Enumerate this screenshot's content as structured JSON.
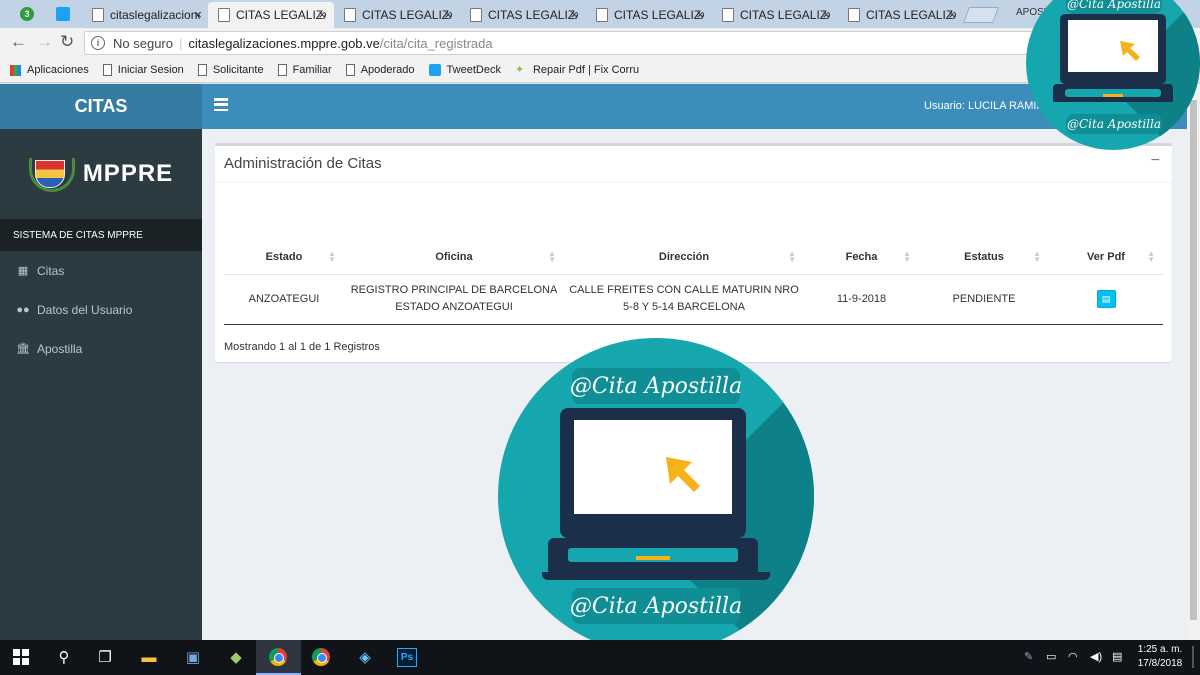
{
  "browser": {
    "pinned_tabs": [
      {
        "icon": "whatsapp-icon",
        "badge": "3"
      },
      {
        "icon": "twitter-icon"
      }
    ],
    "tabs": [
      {
        "title": "citaslegalizaciones",
        "active": false
      },
      {
        "title": "CITAS LEGALIZACIONES",
        "active": true
      },
      {
        "title": "CITAS LEGALIZACIONES",
        "active": false
      },
      {
        "title": "CITAS LEGALIZACIONES",
        "active": false
      },
      {
        "title": "CITAS LEGALIZACIONES",
        "active": false
      },
      {
        "title": "CITAS LEGALIZACIONES",
        "active": false
      },
      {
        "title": "CITAS LEGALIZACIONES",
        "active": false
      }
    ],
    "tab_close": "×",
    "profile_label": "APOSTI",
    "nav": {
      "back": "←",
      "forward": "→",
      "reload": "↻"
    },
    "address": {
      "security": "No seguro",
      "host": "citaslegalizaciones.mppre.gob.ve",
      "path": "/cita/cita_registrada"
    },
    "bookmarks": [
      {
        "label": "Aplicaciones",
        "icon": "apps-grid-icon"
      },
      {
        "label": "Iniciar Sesion",
        "icon": "page-icon"
      },
      {
        "label": "Solicitante",
        "icon": "page-icon"
      },
      {
        "label": "Familiar",
        "icon": "page-icon"
      },
      {
        "label": "Apoderado",
        "icon": "page-icon"
      },
      {
        "label": "TweetDeck",
        "icon": "twitter-icon"
      },
      {
        "label": "Repair Pdf | Fix Corru",
        "icon": "fix-icon"
      }
    ]
  },
  "app": {
    "brand": "CITAS",
    "logo_text": "MPPRE",
    "sidebar_header": "SISTEMA DE CITAS MPPRE",
    "menu": [
      {
        "label": "Citas",
        "icon": "calendar-icon"
      },
      {
        "label": "Datos del Usuario",
        "icon": "users-icon"
      },
      {
        "label": "Apostilla",
        "icon": "institution-icon"
      }
    ],
    "user_label": "Usuario: LUCILA RAMIREZ",
    "colors": {
      "header": "#3c8dbc",
      "sidebar": "#2c3b41",
      "brand": "#357ca5",
      "pdf_button": "#00c0ef"
    }
  },
  "panel": {
    "title": "Administración de Citas",
    "collapse": "−",
    "columns": [
      "Estado",
      "Oficina",
      "Dirección",
      "Fecha",
      "Estatus",
      "Ver Pdf"
    ],
    "rows": [
      {
        "estado": "ANZOATEGUI",
        "oficina_1": "REGISTRO PRINCIPAL DE BARCELONA",
        "oficina_2": "ESTADO ANZOATEGUI",
        "direccion_1": "CALLE FREITES CON CALLE MATURIN NRO",
        "direccion_2": "5-8 Y 5-14 BARCELONA",
        "fecha": "11-9-2018",
        "estatus": "PENDIENTE",
        "pdf_icon": "pdf-file-icon"
      }
    ],
    "footer": "Mostrando 1 al 1 de 1 Registros"
  },
  "watermark": {
    "text": "@Cita Apostilla",
    "colors": {
      "circle": "#16a6ad",
      "laptop": "#1b2f4b",
      "cursor": "#f6b21a"
    }
  },
  "taskbar": {
    "apps": [
      "start-icon",
      "search-icon",
      "task-view-icon",
      "file-explorer-icon",
      "network-app-icon",
      "store-icon",
      "chrome-icon",
      "chrome-icon",
      "notes-icon",
      "photoshop-icon"
    ],
    "photoshop_label": "Ps",
    "time": "1:25 a. m.",
    "date": "17/8/2018"
  }
}
